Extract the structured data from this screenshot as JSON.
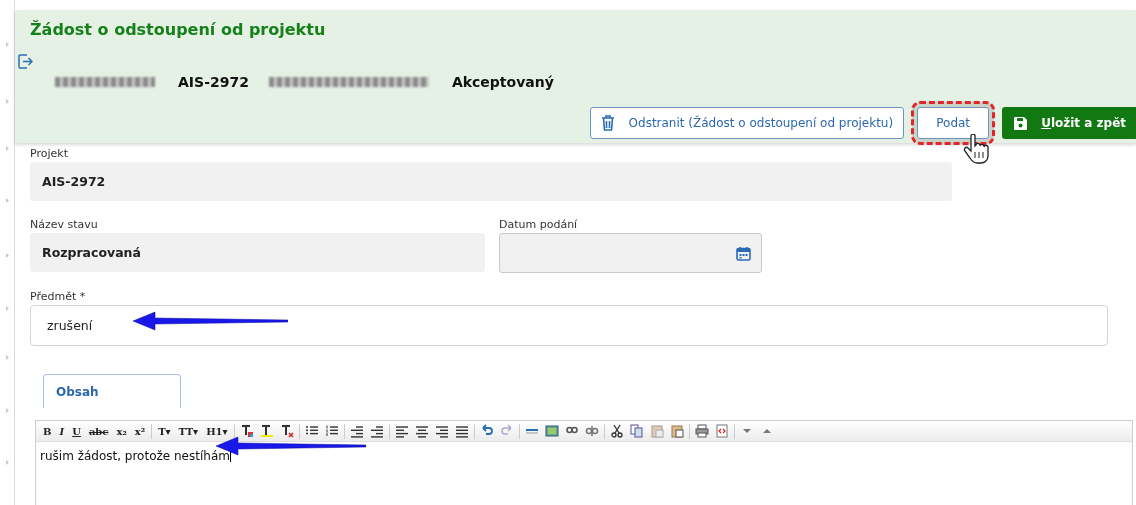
{
  "header": {
    "title": "Žádost o odstoupení od projektu",
    "summary": [
      {
        "kind": "redacted"
      },
      {
        "kind": "text",
        "text": "AIS-2972"
      },
      {
        "kind": "redacted"
      },
      {
        "kind": "text",
        "text": "Akceptovaný"
      }
    ],
    "buttons": [
      {
        "kind": "outline",
        "label": "Odstranit (Žádost o odstoupení od projektu)",
        "highlighted": false
      },
      {
        "kind": "outline",
        "label": "Podat",
        "highlighted": true
      },
      {
        "kind": "primary",
        "label": "Uložit a zpět",
        "highlighted": false
      }
    ]
  },
  "fields": [
    {
      "label": "Projekt",
      "value": "AIS-2972",
      "kind": "readonly"
    },
    {
      "label": "Název stavu",
      "value": "Rozpracovaná",
      "kind": "readonly"
    },
    {
      "label": "Datum podání",
      "kind": "date"
    },
    {
      "label": "Předmět *",
      "value": "zrušení",
      "kind": "input",
      "annotated": true
    }
  ],
  "tabs": [
    {
      "label": "Obsah",
      "selected": true
    }
  ],
  "editor": {
    "text_buttons": [
      "B",
      "I",
      "U",
      "abc",
      "x₂",
      "x²",
      "T▾",
      "TT▾",
      "H1▾"
    ],
    "content": "rušim žádost, protože nestíhám",
    "annotated": true
  }
}
